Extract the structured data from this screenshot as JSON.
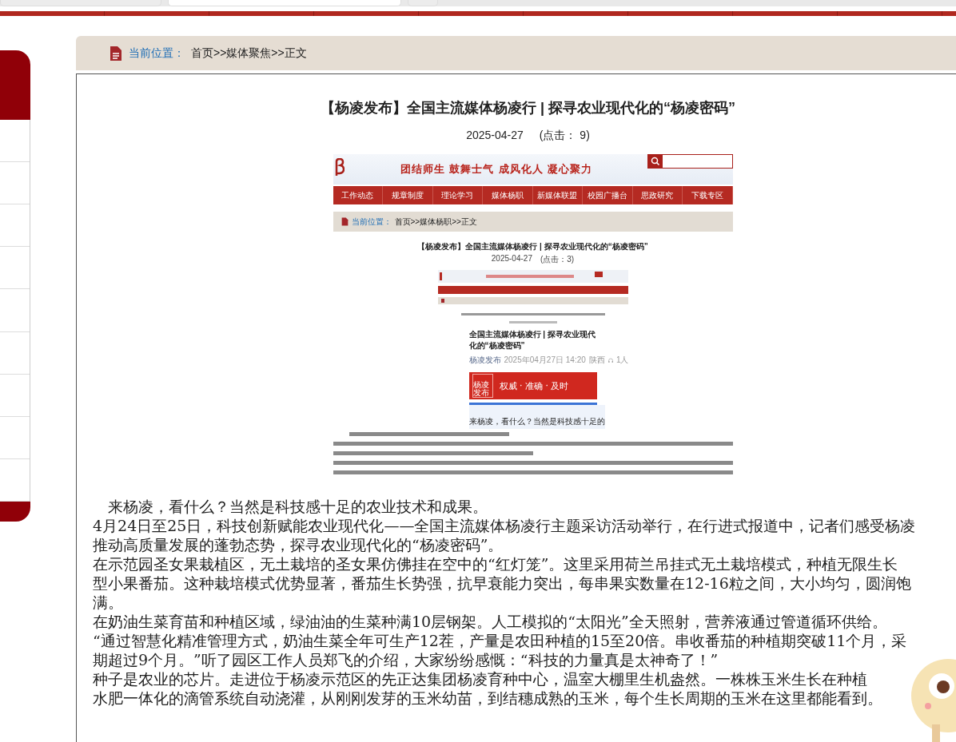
{
  "browser_tabs": [
    {
      "selected": false
    },
    {
      "selected": true
    },
    {
      "selected": false
    }
  ],
  "breadcrumb": {
    "label": "当前位置：",
    "path": "首页>>媒体聚焦>>正文"
  },
  "article": {
    "title": "【杨凌发布】全国主流媒体杨凌行 | 探寻农业现代化的“杨凌密码”",
    "date": "2025-04-27",
    "clicks": "(点击：  9)",
    "image": {
      "slogan": "团结师生 鼓舞士气 成风化人 凝心聚力",
      "nav": [
        "工作动态",
        "规章制度",
        "理论学习",
        "媒体杨职",
        "新媒体联盟",
        "校园广播台",
        "思政研究",
        "下载专区"
      ],
      "breadcrumb": {
        "label": "当前位置：",
        "path": "首页>>媒体杨职>>正文"
      },
      "title": "【杨凌发布】全国主流媒体杨凌行 | 探寻农业现代化的“杨凌密码”",
      "date": "2025-04-27",
      "clicks": "(点击：3)",
      "post": {
        "title": "全国主流媒体杨凌行 | 探寻农业现代化的“杨凌密码”",
        "author": "杨凌发布",
        "time": "2025年04月27日 14:20",
        "location": "陕西",
        "listeners": "1人",
        "banner_logo": "杨凌发布",
        "banner_slogan": "权威 · 准确 · 及时",
        "lead": "来杨凌，看什么？当然是科技感十足的"
      }
    },
    "lines": [
      "　来杨凌，看什么？当然是科技感十足的农业技术和成果。",
      "4月24日至25日，科技创新赋能农业现代化——全国主流媒体杨凌行主题采访活动举行，在行进式报道中，记者们感受杨凌",
      "推动高质量发展的蓬勃态势，探寻农业现代化的“杨凌密码”。",
      "在示范园圣女果栽植区，无土栽培的圣女果仿佛挂在空中的“红灯笼”。这里采用荷兰吊挂式无土栽培模式，种植无限生长",
      "型小果番茄。这种栽培模式优势显著，番茄生长势强，抗早衰能力突出，每串果实数量在12-16粒之间，大小均匀，圆润饱",
      "满。",
      "在奶油生菜育苗和种植区域，绿油油的生菜种满10层钢架。人工模拟的“太阳光”全天照射，营养液通过管道循环供给。",
      "“通过智慧化精准管理方式，奶油生菜全年可生产12茬，产量是农田种植的15至20倍。串收番茄的种植期突破11个月，采",
      "期超过9个月。”听了园区工作人员郑飞的介绍，大家纷纷感慨：“科技的力量真是太神奇了！”",
      "种子是农业的芯片。走进位于杨凌示范区的先正达集团杨凌育种中心，温室大棚里生机盎然。一株株玉米生长在种植",
      "水肥一体化的滴管系统自动浇灌，从刚刚发芽的玉米幼苗，到结穗成熟的玉米，每个生长周期的玉米在这里都能看到。"
    ]
  }
}
